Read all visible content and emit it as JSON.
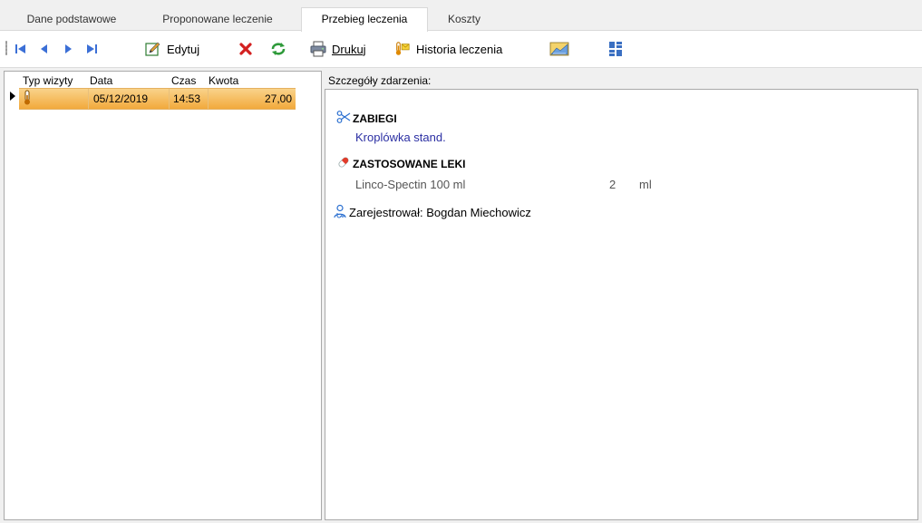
{
  "tabs": [
    {
      "label": "Dane podstawowe",
      "active": false
    },
    {
      "label": "Proponowane leczenie",
      "active": false
    },
    {
      "label": "Przebieg leczenia",
      "active": true
    },
    {
      "label": "Koszty",
      "active": false
    }
  ],
  "toolbar": {
    "edit_label": "Edytuj",
    "print_label": "Drukuj",
    "history_label": "Historia leczenia"
  },
  "grid": {
    "headers": [
      "Typ wizyty",
      "Data",
      "Czas",
      "Kwota"
    ],
    "rows": [
      {
        "date": "05/12/2019",
        "time": "14:53",
        "amount": "27,00"
      }
    ]
  },
  "details": {
    "label": "Szczegóły zdarzenia:",
    "procedures_title": "ZABIEGI",
    "procedure": "Kroplówka stand.",
    "drugs_title": "ZASTOSOWANE LEKI",
    "drug_name": "Linco-Spectin 100 ml",
    "drug_qty": "2",
    "drug_unit": "ml",
    "registered_by": "Zarejestrował: Bogdan Miechowicz"
  },
  "colors": {
    "selection": "#f2a93c",
    "nav_blue": "#3b6fd6",
    "delete_red": "#d32020",
    "refresh_green": "#2e9a3a",
    "link_blue": "#2b2fa3"
  }
}
